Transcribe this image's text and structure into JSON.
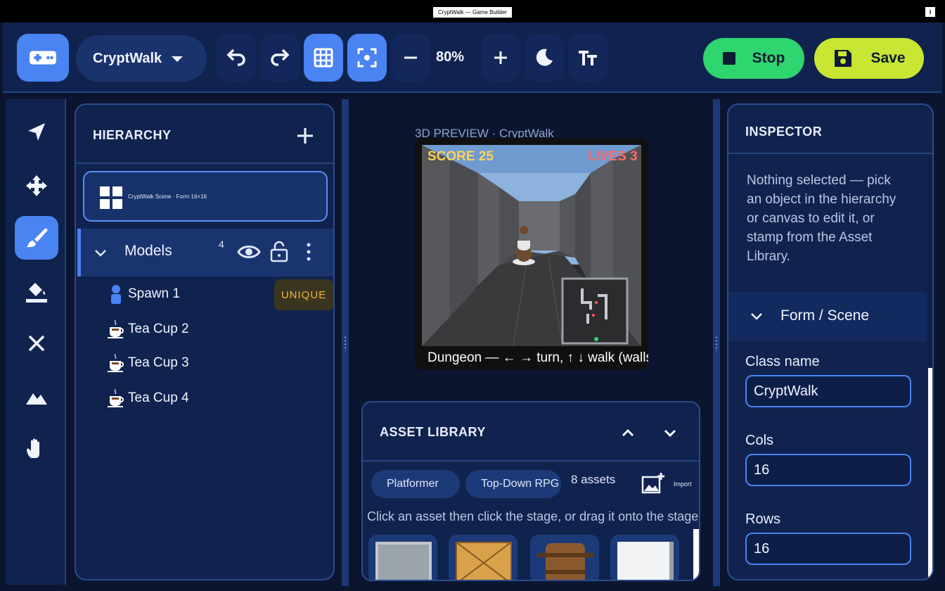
{
  "window": {
    "title": "CryptWalk — Game Builder",
    "info": "i"
  },
  "toolbar": {
    "project_name": "CryptWalk",
    "zoom": "80%",
    "stop_label": "Stop",
    "save_label": "Save"
  },
  "hierarchy": {
    "title": "HIERARCHY",
    "scene_label": "CryptWalk Scene · Form 16×16",
    "group": {
      "name": "Models",
      "count": "4"
    },
    "items": [
      {
        "label": "Spawn 1",
        "badge": "UNIQUE"
      },
      {
        "label": "Tea Cup 2"
      },
      {
        "label": "Tea Cup 3"
      },
      {
        "label": "Tea Cup 4"
      }
    ]
  },
  "preview": {
    "title": "3D PREVIEW · CryptWalk",
    "score": "SCORE 25",
    "lives": "LIVES 3",
    "caption": "Dungeon — ← → turn, ↑ ↓ walk (walls block)"
  },
  "assets": {
    "title": "ASSET LIBRARY",
    "tabs": [
      "Platformer",
      "Top-Down RPG"
    ],
    "count": "8 assets",
    "import_label": "Import",
    "hint": "Click an asset then click the stage, or drag it onto the stage."
  },
  "inspector": {
    "title": "INSPECTOR",
    "message": "Nothing selected — pick an object in the hierarchy or canvas to edit it, or stamp from the Asset Library.",
    "section": "Form / Scene",
    "fields": [
      {
        "label": "Class name",
        "value": "CryptWalk"
      },
      {
        "label": "Cols",
        "value": "16"
      },
      {
        "label": "Rows",
        "value": "16"
      }
    ]
  },
  "colors": {
    "accent": "#4a83f2",
    "stop": "#2fd56e",
    "save": "#c8e632",
    "score": "#ffd15c",
    "lives": "#ff6b6b",
    "badge": "#f5b63a"
  }
}
